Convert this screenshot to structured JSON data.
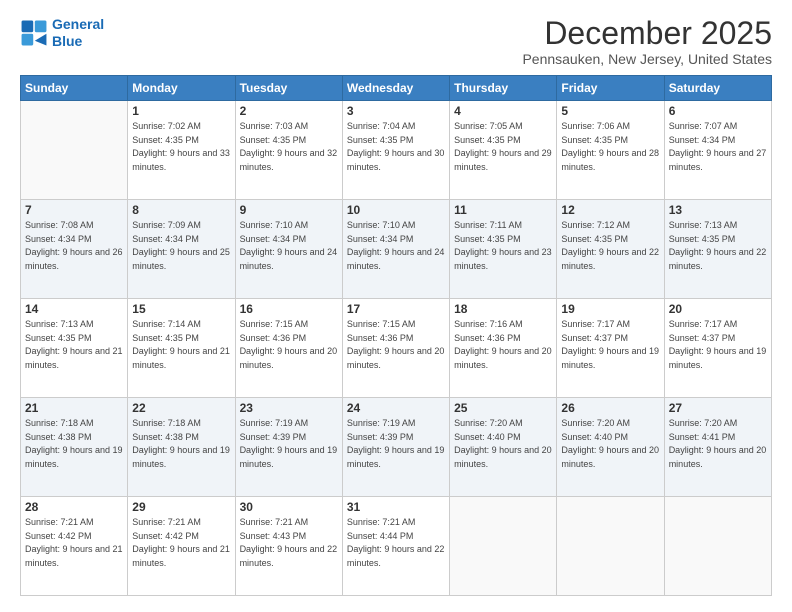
{
  "logo": {
    "line1": "General",
    "line2": "Blue"
  },
  "title": "December 2025",
  "location": "Pennsauken, New Jersey, United States",
  "weekdays": [
    "Sunday",
    "Monday",
    "Tuesday",
    "Wednesday",
    "Thursday",
    "Friday",
    "Saturday"
  ],
  "weeks": [
    [
      {
        "day": "",
        "sunrise": "",
        "sunset": "",
        "daylight": ""
      },
      {
        "day": "1",
        "sunrise": "Sunrise: 7:02 AM",
        "sunset": "Sunset: 4:35 PM",
        "daylight": "Daylight: 9 hours and 33 minutes."
      },
      {
        "day": "2",
        "sunrise": "Sunrise: 7:03 AM",
        "sunset": "Sunset: 4:35 PM",
        "daylight": "Daylight: 9 hours and 32 minutes."
      },
      {
        "day": "3",
        "sunrise": "Sunrise: 7:04 AM",
        "sunset": "Sunset: 4:35 PM",
        "daylight": "Daylight: 9 hours and 30 minutes."
      },
      {
        "day": "4",
        "sunrise": "Sunrise: 7:05 AM",
        "sunset": "Sunset: 4:35 PM",
        "daylight": "Daylight: 9 hours and 29 minutes."
      },
      {
        "day": "5",
        "sunrise": "Sunrise: 7:06 AM",
        "sunset": "Sunset: 4:35 PM",
        "daylight": "Daylight: 9 hours and 28 minutes."
      },
      {
        "day": "6",
        "sunrise": "Sunrise: 7:07 AM",
        "sunset": "Sunset: 4:34 PM",
        "daylight": "Daylight: 9 hours and 27 minutes."
      }
    ],
    [
      {
        "day": "7",
        "sunrise": "Sunrise: 7:08 AM",
        "sunset": "Sunset: 4:34 PM",
        "daylight": "Daylight: 9 hours and 26 minutes."
      },
      {
        "day": "8",
        "sunrise": "Sunrise: 7:09 AM",
        "sunset": "Sunset: 4:34 PM",
        "daylight": "Daylight: 9 hours and 25 minutes."
      },
      {
        "day": "9",
        "sunrise": "Sunrise: 7:10 AM",
        "sunset": "Sunset: 4:34 PM",
        "daylight": "Daylight: 9 hours and 24 minutes."
      },
      {
        "day": "10",
        "sunrise": "Sunrise: 7:10 AM",
        "sunset": "Sunset: 4:34 PM",
        "daylight": "Daylight: 9 hours and 24 minutes."
      },
      {
        "day": "11",
        "sunrise": "Sunrise: 7:11 AM",
        "sunset": "Sunset: 4:35 PM",
        "daylight": "Daylight: 9 hours and 23 minutes."
      },
      {
        "day": "12",
        "sunrise": "Sunrise: 7:12 AM",
        "sunset": "Sunset: 4:35 PM",
        "daylight": "Daylight: 9 hours and 22 minutes."
      },
      {
        "day": "13",
        "sunrise": "Sunrise: 7:13 AM",
        "sunset": "Sunset: 4:35 PM",
        "daylight": "Daylight: 9 hours and 22 minutes."
      }
    ],
    [
      {
        "day": "14",
        "sunrise": "Sunrise: 7:13 AM",
        "sunset": "Sunset: 4:35 PM",
        "daylight": "Daylight: 9 hours and 21 minutes."
      },
      {
        "day": "15",
        "sunrise": "Sunrise: 7:14 AM",
        "sunset": "Sunset: 4:35 PM",
        "daylight": "Daylight: 9 hours and 21 minutes."
      },
      {
        "day": "16",
        "sunrise": "Sunrise: 7:15 AM",
        "sunset": "Sunset: 4:36 PM",
        "daylight": "Daylight: 9 hours and 20 minutes."
      },
      {
        "day": "17",
        "sunrise": "Sunrise: 7:15 AM",
        "sunset": "Sunset: 4:36 PM",
        "daylight": "Daylight: 9 hours and 20 minutes."
      },
      {
        "day": "18",
        "sunrise": "Sunrise: 7:16 AM",
        "sunset": "Sunset: 4:36 PM",
        "daylight": "Daylight: 9 hours and 20 minutes."
      },
      {
        "day": "19",
        "sunrise": "Sunrise: 7:17 AM",
        "sunset": "Sunset: 4:37 PM",
        "daylight": "Daylight: 9 hours and 19 minutes."
      },
      {
        "day": "20",
        "sunrise": "Sunrise: 7:17 AM",
        "sunset": "Sunset: 4:37 PM",
        "daylight": "Daylight: 9 hours and 19 minutes."
      }
    ],
    [
      {
        "day": "21",
        "sunrise": "Sunrise: 7:18 AM",
        "sunset": "Sunset: 4:38 PM",
        "daylight": "Daylight: 9 hours and 19 minutes."
      },
      {
        "day": "22",
        "sunrise": "Sunrise: 7:18 AM",
        "sunset": "Sunset: 4:38 PM",
        "daylight": "Daylight: 9 hours and 19 minutes."
      },
      {
        "day": "23",
        "sunrise": "Sunrise: 7:19 AM",
        "sunset": "Sunset: 4:39 PM",
        "daylight": "Daylight: 9 hours and 19 minutes."
      },
      {
        "day": "24",
        "sunrise": "Sunrise: 7:19 AM",
        "sunset": "Sunset: 4:39 PM",
        "daylight": "Daylight: 9 hours and 19 minutes."
      },
      {
        "day": "25",
        "sunrise": "Sunrise: 7:20 AM",
        "sunset": "Sunset: 4:40 PM",
        "daylight": "Daylight: 9 hours and 20 minutes."
      },
      {
        "day": "26",
        "sunrise": "Sunrise: 7:20 AM",
        "sunset": "Sunset: 4:40 PM",
        "daylight": "Daylight: 9 hours and 20 minutes."
      },
      {
        "day": "27",
        "sunrise": "Sunrise: 7:20 AM",
        "sunset": "Sunset: 4:41 PM",
        "daylight": "Daylight: 9 hours and 20 minutes."
      }
    ],
    [
      {
        "day": "28",
        "sunrise": "Sunrise: 7:21 AM",
        "sunset": "Sunset: 4:42 PM",
        "daylight": "Daylight: 9 hours and 21 minutes."
      },
      {
        "day": "29",
        "sunrise": "Sunrise: 7:21 AM",
        "sunset": "Sunset: 4:42 PM",
        "daylight": "Daylight: 9 hours and 21 minutes."
      },
      {
        "day": "30",
        "sunrise": "Sunrise: 7:21 AM",
        "sunset": "Sunset: 4:43 PM",
        "daylight": "Daylight: 9 hours and 22 minutes."
      },
      {
        "day": "31",
        "sunrise": "Sunrise: 7:21 AM",
        "sunset": "Sunset: 4:44 PM",
        "daylight": "Daylight: 9 hours and 22 minutes."
      },
      {
        "day": "",
        "sunrise": "",
        "sunset": "",
        "daylight": ""
      },
      {
        "day": "",
        "sunrise": "",
        "sunset": "",
        "daylight": ""
      },
      {
        "day": "",
        "sunrise": "",
        "sunset": "",
        "daylight": ""
      }
    ]
  ]
}
